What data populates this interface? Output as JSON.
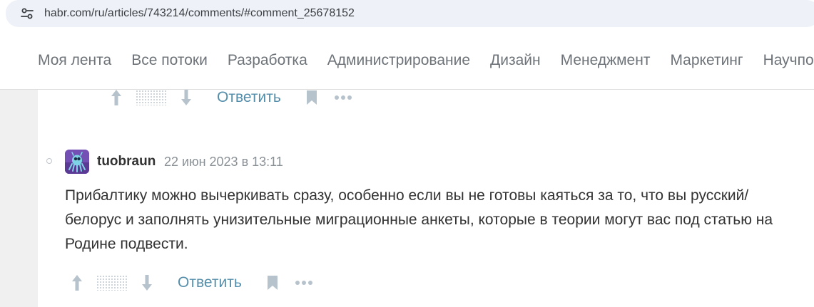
{
  "browser": {
    "url": "habr.com/ru/articles/743214/comments/#comment_25678152",
    "site_icon": "tune-icon"
  },
  "nav": {
    "items": [
      "Моя лента",
      "Все потоки",
      "Разработка",
      "Администрирование",
      "Дизайн",
      "Менеджмент",
      "Маркетинг",
      "Научпоп"
    ]
  },
  "prev_comment_actions": {
    "reply_label": "Ответить"
  },
  "comment": {
    "author": "tuobraun",
    "timestamp": "22 июн 2023 в 13:11",
    "text": "Прибалтику можно вычеркивать сразу, особенно если вы не готовы каяться за то, что вы русский/белорус и заполнять унизительные миграционные анкеты, которые в теории могут вас под статью на Родине подвести.",
    "reply_label": "Ответить"
  },
  "colors": {
    "accent_link": "#548eaa",
    "icon_gray": "#b6c2cc",
    "nav_text": "#6d7378",
    "page_bg": "#f0f0f0"
  }
}
